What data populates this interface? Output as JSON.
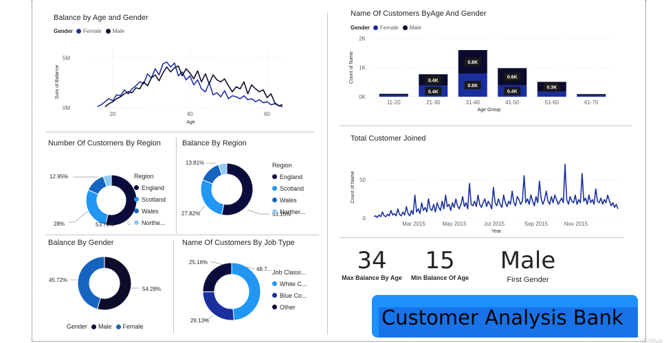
{
  "colors": {
    "female": "#1f2fa5",
    "male": "#0d0d2b",
    "england": "#0c0c3c",
    "scotland": "#2196f3",
    "wales": "#1565c0",
    "northern": "#90caf9",
    "bar_light": "#1a2f9e",
    "bar_dark": "#0b0b2e",
    "banner": "#1e90ff"
  },
  "panels": {
    "balance_age_gender": {
      "title": "Balance by Age and Gender",
      "legend_title": "Gender",
      "legend_female": "Female",
      "legend_male": "Male"
    },
    "customers_age_gender": {
      "title": "Name Of Customers ByAge And Gender",
      "legend_title": "Gender",
      "legend_female": "Female",
      "legend_male": "Male"
    },
    "customers_region": {
      "title": "Number Of Customers By Region",
      "legend_title": "Region",
      "items": [
        "England",
        "Scotland",
        "Wales",
        "Northe..."
      ]
    },
    "balance_region": {
      "title": "Balance By Region",
      "legend_title": "Region",
      "items": [
        "England",
        "Scotland",
        "Wales",
        "Norther..."
      ]
    },
    "total_customer_joined": {
      "title": "Total Customer Joined"
    },
    "balance_gender": {
      "title": "Balance By Gender",
      "legend_title": "Gender",
      "legend_male": "Male",
      "legend_female": "Female"
    },
    "customers_job_type": {
      "title": "Name Of Customers By Job Type",
      "legend_title": "Job Classi...",
      "items": [
        "White C...",
        "Blue Co...",
        "Other"
      ]
    }
  },
  "kpis": {
    "max_balance": {
      "value": "34",
      "label": "Max Balance By Age"
    },
    "min_balance": {
      "value": "15",
      "label": "Min Balance Of Age"
    },
    "first_gender": {
      "value": "Male",
      "label": "First Gender"
    }
  },
  "banner": {
    "text": "Customer Analysis Bank"
  },
  "watermark": "Activa",
  "chart_data": [
    {
      "id": "balance_by_age_gender",
      "type": "line",
      "title": "Balance by Age and Gender",
      "xlabel": "Age",
      "ylabel": "Sum of Balance",
      "xticks": [
        "20",
        "40",
        "60"
      ],
      "yticks": [
        "0M",
        "5M"
      ],
      "xlim": [
        15,
        64
      ],
      "ylim": [
        0,
        6
      ],
      "series": [
        {
          "name": "Female",
          "x": [
            16,
            17,
            18,
            19,
            20,
            21,
            22,
            23,
            24,
            25,
            26,
            27,
            28,
            29,
            30,
            31,
            32,
            33,
            34,
            35,
            36,
            37,
            38,
            39,
            40,
            41,
            42,
            43,
            44,
            45,
            46,
            47,
            48,
            49,
            50,
            51,
            52,
            53,
            54,
            55,
            56,
            57,
            58,
            59,
            60,
            61,
            62,
            63,
            64
          ],
          "y": [
            0.1,
            0.3,
            0.6,
            0.9,
            0.7,
            1.3,
            1.2,
            1.8,
            1.4,
            1.9,
            2.2,
            2.6,
            2.4,
            3.4,
            3.0,
            3.9,
            3.3,
            4.4,
            4.6,
            4.1,
            4.5,
            3.2,
            3.6,
            2.8,
            3.2,
            2.3,
            2.8,
            1.9,
            1.6,
            2.5,
            1.3,
            1.5,
            1.1,
            1.7,
            0.9,
            1.2,
            1.1,
            0.9,
            1.2,
            0.8,
            0.9,
            0.6,
            0.8,
            0.5,
            0.6,
            0.3,
            0.4,
            0.2,
            0.1
          ]
        },
        {
          "name": "Male",
          "x": [
            18,
            19,
            20,
            21,
            22,
            23,
            24,
            25,
            26,
            27,
            28,
            29,
            30,
            31,
            32,
            33,
            34,
            35,
            36,
            37,
            38,
            39,
            40,
            41,
            42,
            43,
            44,
            45,
            46,
            47,
            48,
            49,
            50,
            51,
            52,
            53,
            54,
            55,
            56,
            57,
            58,
            59,
            60,
            61,
            62,
            63,
            64
          ],
          "y": [
            0.1,
            0.4,
            0.6,
            0.9,
            1.1,
            1.4,
            1.6,
            1.5,
            2.0,
            1.9,
            2.6,
            2.2,
            3.0,
            3.3,
            2.7,
            3.5,
            4.1,
            3.6,
            4.0,
            4.2,
            3.2,
            3.9,
            3.5,
            2.9,
            3.7,
            2.6,
            3.4,
            2.4,
            3.3,
            2.8,
            2.6,
            2.9,
            2.2,
            1.6,
            2.1,
            1.9,
            2.6,
            1.4,
            2.3,
            1.9,
            1.6,
            1.8,
            1.0,
            1.4,
            0.5,
            0.2,
            0.3
          ]
        }
      ]
    },
    {
      "id": "customers_by_age_gender",
      "type": "bar",
      "title": "Name Of Customers ByAge And Gender",
      "xlabel": "Age Group",
      "ylabel": "Count of Name",
      "categories": [
        "11-20",
        "21-30",
        "31-40",
        "41-50",
        "51-60",
        "61-70"
      ],
      "yticks": [
        "0K",
        "1K",
        "2K"
      ],
      "ylim": [
        0,
        2000
      ],
      "series": [
        {
          "name": "Female",
          "values": [
            60,
            380,
            800,
            400,
            170,
            50
          ],
          "labels": [
            "",
            "0.4K",
            "0.8K",
            "0.4K",
            "",
            ""
          ]
        },
        {
          "name": "Male",
          "values": [
            40,
            390,
            800,
            580,
            340,
            40
          ],
          "labels": [
            "",
            "0.4K",
            "0.8K",
            "0.6K",
            "0.3K",
            ""
          ]
        }
      ]
    },
    {
      "id": "customers_by_region",
      "type": "pie",
      "title": "Number Of Customers By Region",
      "categories": [
        "England",
        "Scotland",
        "Wales",
        "Northern Ireland"
      ],
      "values": [
        53.79,
        28.0,
        12.95,
        5.26
      ],
      "data_labels": [
        "53.79%",
        "28%",
        "12.95%"
      ]
    },
    {
      "id": "balance_by_region",
      "type": "pie",
      "title": "Balance By Region",
      "categories": [
        "England",
        "Scotland",
        "Wales",
        "Northern Ireland"
      ],
      "values": [
        53.15,
        27.82,
        13.81,
        5.22
      ],
      "data_labels": [
        "53.15%",
        "27.82%",
        "13.81%"
      ]
    },
    {
      "id": "total_customer_joined",
      "type": "line",
      "title": "Total Customer Joined",
      "xlabel": "Year",
      "ylabel": "Count of Name",
      "xticks": [
        "Mar 2015",
        "May 2015",
        "Jul 2015",
        "Sep 2015",
        "Nov 2015"
      ],
      "yticks": [
        "0",
        "50"
      ],
      "ylim": [
        0,
        80
      ],
      "series": [
        {
          "name": "Customers",
          "values": [
            2,
            3,
            1,
            4,
            2,
            8,
            3,
            2,
            5,
            3,
            10,
            4,
            6,
            3,
            12,
            5,
            3,
            8,
            4,
            15,
            6,
            3,
            10,
            5,
            30,
            8,
            12,
            6,
            20,
            10,
            14,
            8,
            25,
            12,
            10,
            18,
            8,
            20,
            14,
            10,
            22,
            12,
            30,
            15,
            18,
            10,
            20,
            14,
            25,
            16,
            12,
            18,
            28,
            15,
            20,
            12,
            45,
            18,
            16,
            22,
            15,
            30,
            18,
            14,
            20,
            25,
            15,
            22,
            18,
            12,
            40,
            20,
            16,
            25,
            18,
            14,
            30,
            20,
            15,
            22,
            18,
            35,
            20,
            16,
            28,
            24,
            18,
            22,
            55,
            20,
            25,
            18,
            30,
            22,
            16,
            28,
            20,
            48,
            25,
            18,
            24,
            35,
            22,
            18,
            28,
            20,
            30,
            24,
            18,
            22,
            26,
            20,
            70,
            24,
            18,
            28,
            22,
            20,
            30,
            18,
            24,
            20,
            58,
            22,
            26,
            18,
            30,
            20,
            24,
            18,
            38,
            22,
            20,
            26,
            18,
            24,
            20,
            30,
            22,
            16,
            20,
            14,
            18,
            12
          ]
        }
      ]
    },
    {
      "id": "balance_by_gender",
      "type": "pie",
      "title": "Balance By Gender",
      "categories": [
        "Male",
        "Female"
      ],
      "values": [
        54.28,
        45.72
      ],
      "data_labels": [
        "54.28%",
        "45.72%"
      ]
    },
    {
      "id": "customers_by_job_type",
      "type": "pie",
      "title": "Name Of Customers By Job Type",
      "categories": [
        "White Collar",
        "Blue Collar",
        "Other"
      ],
      "values": [
        48.7,
        26.13,
        25.16
      ],
      "data_labels": [
        "48.7...",
        "26.13%",
        "25.16%"
      ]
    }
  ]
}
